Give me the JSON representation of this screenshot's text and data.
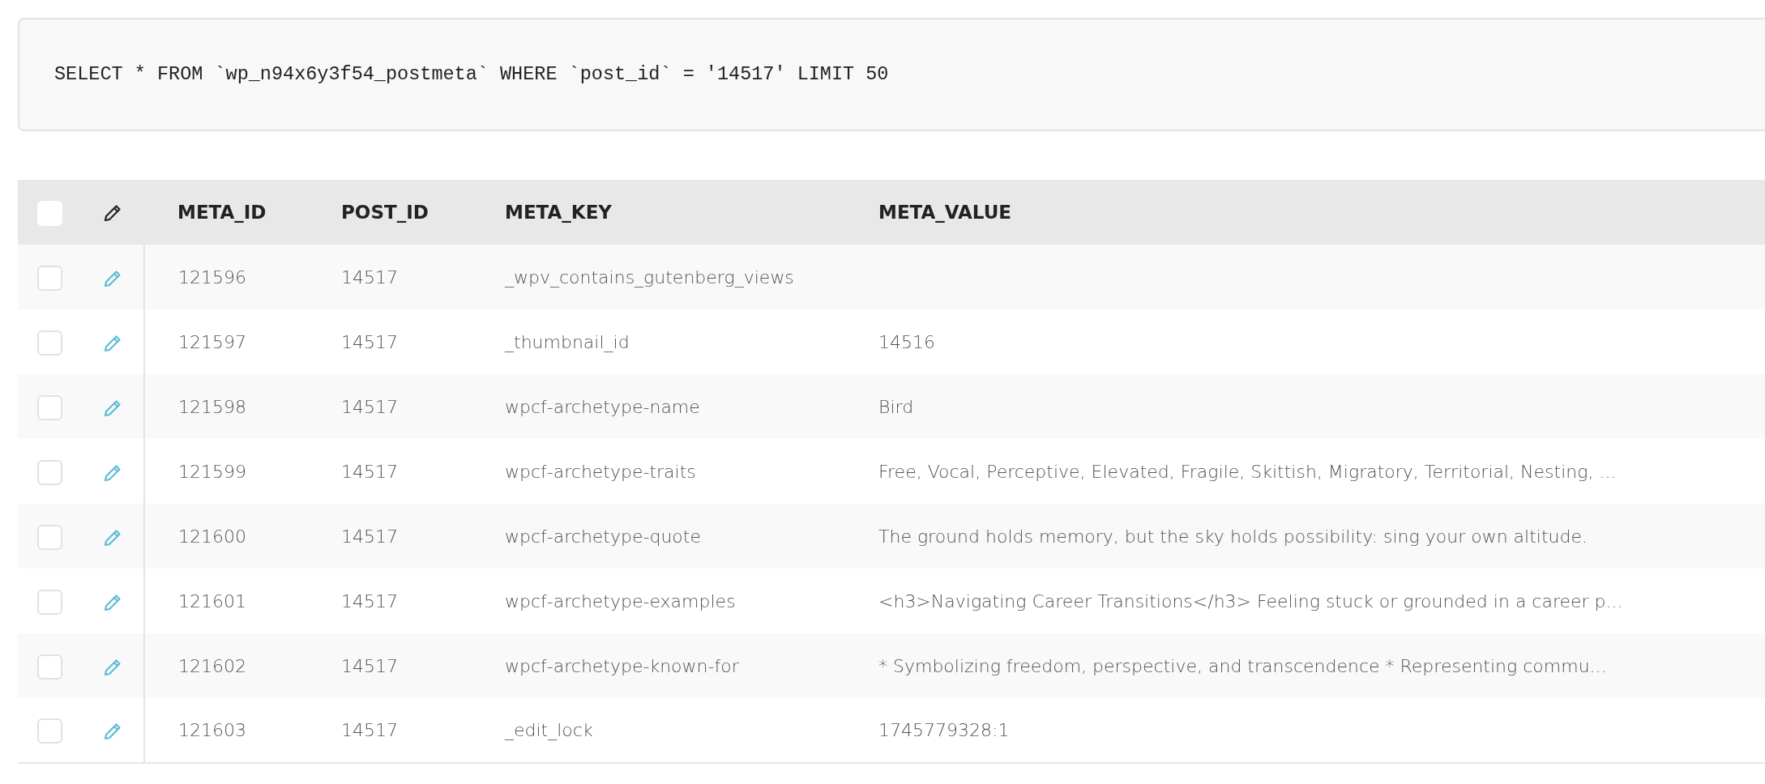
{
  "query": "SELECT * FROM `wp_n94x6y3f54_postmeta` WHERE `post_id` = '14517' LIMIT 50",
  "table": {
    "select_all": {
      "checked": false
    },
    "columns": [
      "META_ID",
      "POST_ID",
      "META_KEY",
      "META_VALUE"
    ],
    "rows": [
      {
        "checked": false,
        "cells": [
          "121596",
          "14517",
          "_wpv_contains_gutenberg_views",
          ""
        ]
      },
      {
        "checked": false,
        "cells": [
          "121597",
          "14517",
          "_thumbnail_id",
          "14516"
        ]
      },
      {
        "checked": false,
        "cells": [
          "121598",
          "14517",
          "wpcf-archetype-name",
          "Bird"
        ]
      },
      {
        "checked": false,
        "cells": [
          "121599",
          "14517",
          "wpcf-archetype-traits",
          "Free, Vocal, Perceptive, Elevated, Fragile, Skittish, Migratory, Territorial, Nesting, ..."
        ]
      },
      {
        "checked": false,
        "cells": [
          "121600",
          "14517",
          "wpcf-archetype-quote",
          "The ground holds memory, but the sky holds possibility: sing your own altitude."
        ]
      },
      {
        "checked": false,
        "cells": [
          "121601",
          "14517",
          "wpcf-archetype-examples",
          "<h3>Navigating Career Transitions</h3> Feeling stuck or grounded in a career p..."
        ]
      },
      {
        "checked": false,
        "cells": [
          "121602",
          "14517",
          "wpcf-archetype-known-for",
          "* Symbolizing freedom, perspective, and transcendence * Representing commu..."
        ]
      },
      {
        "checked": false,
        "cells": [
          "121603",
          "14517",
          "_edit_lock",
          "1745779328:1"
        ]
      }
    ]
  }
}
